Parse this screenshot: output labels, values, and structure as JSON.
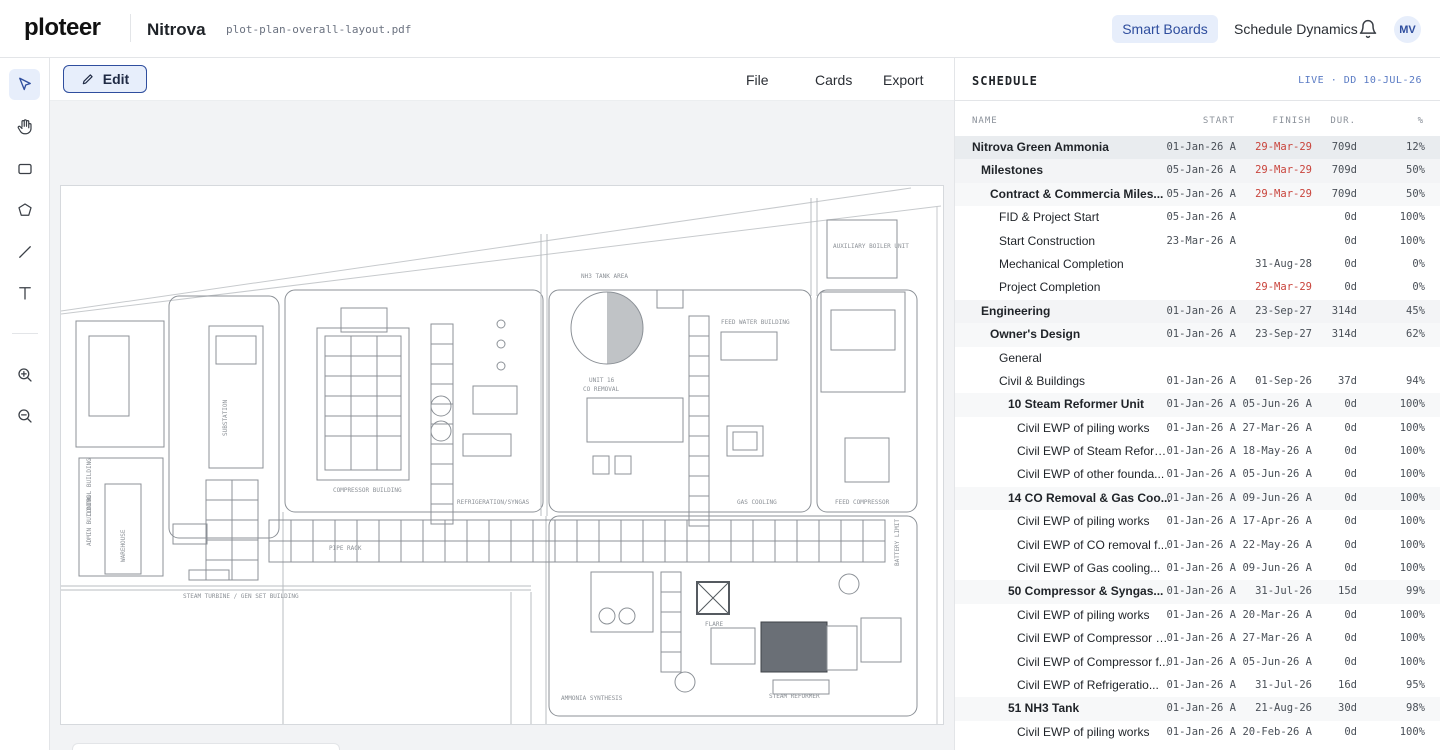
{
  "header": {
    "logo": "ploteer",
    "project": "Nitrova",
    "file": "plot-plan-overall-layout.pdf",
    "smart_boards": "Smart Boards",
    "schedule_dynamics": "Schedule Dynamics",
    "avatar": "MV",
    "icons": {
      "bell": "bell-icon"
    }
  },
  "toolbar": {
    "tools": [
      "cursor-icon",
      "hand-icon",
      "rectangle-icon",
      "polygon-icon",
      "line-icon",
      "text-icon",
      "zoom-in-icon",
      "zoom-out-icon"
    ],
    "active": "cursor-icon"
  },
  "canvas": {
    "edit_label": "Edit",
    "menu": {
      "file": "File",
      "cards": "Cards",
      "export": "Export"
    },
    "drawing_labels": {
      "nh3_tank_area": "NH3 TANK AREA",
      "unit": "UNIT 16",
      "co_removal": "CO REMOVAL",
      "substation": "SUBSTATION",
      "compressor_building": "COMPRESSOR BUILDING",
      "refrigeration_syngas": "REFRIGERATION/SYNGAS",
      "gas_cooling": "GAS COOLING",
      "feed_compressor": "FEED COMPRESSOR",
      "pipe_rack": "PIPE RACK",
      "steam_turbine": "STEAM TURBINE / GEN SET BUILDING",
      "battery_limit": "BATTERY LIMIT",
      "ammonia_synthesis": "AMMONIA SYNTHESIS",
      "control_building": "CONTROL BUILDING",
      "admin_building": "ADMIN BUILDING",
      "warehouse": "WAREHOUSE",
      "auxiliary_boiler": "AUXILIARY BOILER UNIT",
      "feed_water": "FEED WATER BUILDING",
      "reformer": "STEAM REFORMER",
      "flare": "FLARE"
    }
  },
  "schedule": {
    "title": "SCHEDULE",
    "live": "LIVE · DD 10-JUL-26",
    "columns": {
      "name": "NAME",
      "start": "START",
      "finish": "FINISH",
      "dur": "DUR.",
      "pct": "%"
    },
    "rows": [
      {
        "name": "Nitrova Green Ammonia",
        "level": 0,
        "start": "01-Jan-26 A",
        "finish": "29-Mar-29",
        "finish_late": true,
        "dur": "709d",
        "pct": "12%"
      },
      {
        "name": "Milestones",
        "level": 1,
        "start": "05-Jan-26 A",
        "finish": "29-Mar-29",
        "finish_late": true,
        "dur": "709d",
        "pct": "50%"
      },
      {
        "name": "Contract & Commercia Miles...",
        "level": 2,
        "start": "05-Jan-26 A",
        "finish": "29-Mar-29",
        "finish_late": true,
        "dur": "709d",
        "pct": "50%"
      },
      {
        "name": "FID & Project Start",
        "level": 3,
        "start": "05-Jan-26 A",
        "finish": "",
        "finish_late": false,
        "dur": "0d",
        "pct": "100%"
      },
      {
        "name": "Start Construction",
        "level": 3,
        "start": "23-Mar-26 A",
        "finish": "",
        "finish_late": false,
        "dur": "0d",
        "pct": "100%"
      },
      {
        "name": "Mechanical Completion",
        "level": 3,
        "start": "",
        "finish": "31-Aug-28",
        "finish_late": false,
        "dur": "0d",
        "pct": "0%"
      },
      {
        "name": "Project Completion",
        "level": 3,
        "start": "",
        "finish": "29-Mar-29",
        "finish_late": true,
        "dur": "0d",
        "pct": "0%"
      },
      {
        "name": "Engineering",
        "level": 1,
        "start": "01-Jan-26 A",
        "finish": "23-Sep-27",
        "finish_late": false,
        "dur": "314d",
        "pct": "45%"
      },
      {
        "name": "Owner's Design",
        "level": 2,
        "start": "01-Jan-26 A",
        "finish": "23-Sep-27",
        "finish_late": false,
        "dur": "314d",
        "pct": "62%"
      },
      {
        "name": "General",
        "level": 3,
        "start": "",
        "finish": "",
        "finish_late": false,
        "dur": "",
        "pct": ""
      },
      {
        "name": "Civil & Buildings",
        "level": 3,
        "start": "01-Jan-26 A",
        "finish": "01-Sep-26",
        "finish_late": false,
        "dur": "37d",
        "pct": "94%"
      },
      {
        "name": "10 Steam Reformer Unit",
        "level": 4,
        "start": "01-Jan-26 A",
        "finish": "05-Jun-26 A",
        "finish_late": false,
        "dur": "0d",
        "pct": "100%"
      },
      {
        "name": "Civil EWP of piling works",
        "level": 5,
        "start": "01-Jan-26 A",
        "finish": "27-Mar-26 A",
        "finish_late": false,
        "dur": "0d",
        "pct": "100%"
      },
      {
        "name": "Civil EWP of Steam Reform...",
        "level": 5,
        "start": "01-Jan-26 A",
        "finish": "18-May-26 A",
        "finish_late": false,
        "dur": "0d",
        "pct": "100%"
      },
      {
        "name": "Civil EWP of other founda...",
        "level": 5,
        "start": "01-Jan-26 A",
        "finish": "05-Jun-26 A",
        "finish_late": false,
        "dur": "0d",
        "pct": "100%"
      },
      {
        "name": "14 CO Removal & Gas Coo...",
        "level": 4,
        "start": "01-Jan-26 A",
        "finish": "09-Jun-26 A",
        "finish_late": false,
        "dur": "0d",
        "pct": "100%"
      },
      {
        "name": "Civil EWP of piling works",
        "level": 5,
        "start": "01-Jan-26 A",
        "finish": "17-Apr-26 A",
        "finish_late": false,
        "dur": "0d",
        "pct": "100%"
      },
      {
        "name": "Civil EWP of CO removal f...",
        "level": 5,
        "start": "01-Jan-26 A",
        "finish": "22-May-26 A",
        "finish_late": false,
        "dur": "0d",
        "pct": "100%"
      },
      {
        "name": "Civil EWP of Gas cooling...",
        "level": 5,
        "start": "01-Jan-26 A",
        "finish": "09-Jun-26 A",
        "finish_late": false,
        "dur": "0d",
        "pct": "100%"
      },
      {
        "name": "50 Compressor & Syngas...",
        "level": 4,
        "start": "01-Jan-26 A",
        "finish": "31-Jul-26",
        "finish_late": false,
        "dur": "15d",
        "pct": "99%"
      },
      {
        "name": "Civil EWP of piling works",
        "level": 5,
        "start": "01-Jan-26 A",
        "finish": "20-Mar-26 A",
        "finish_late": false,
        "dur": "0d",
        "pct": "100%"
      },
      {
        "name": "Civil EWP of Compressor w...",
        "level": 5,
        "start": "01-Jan-26 A",
        "finish": "27-Mar-26 A",
        "finish_late": false,
        "dur": "0d",
        "pct": "100%"
      },
      {
        "name": "Civil EWP of Compressor f...",
        "level": 5,
        "start": "01-Jan-26 A",
        "finish": "05-Jun-26 A",
        "finish_late": false,
        "dur": "0d",
        "pct": "100%"
      },
      {
        "name": "Civil EWP of Refrigeratio...",
        "level": 5,
        "start": "01-Jan-26 A",
        "finish": "31-Jul-26",
        "finish_late": false,
        "dur": "16d",
        "pct": "95%"
      },
      {
        "name": "51 NH3 Tank",
        "level": 4,
        "start": "01-Jan-26 A",
        "finish": "21-Aug-26",
        "finish_late": false,
        "dur": "30d",
        "pct": "98%"
      },
      {
        "name": "Civil EWP of piling works",
        "level": 5,
        "start": "01-Jan-26 A",
        "finish": "20-Feb-26 A",
        "finish_late": false,
        "dur": "0d",
        "pct": "100%"
      }
    ]
  }
}
